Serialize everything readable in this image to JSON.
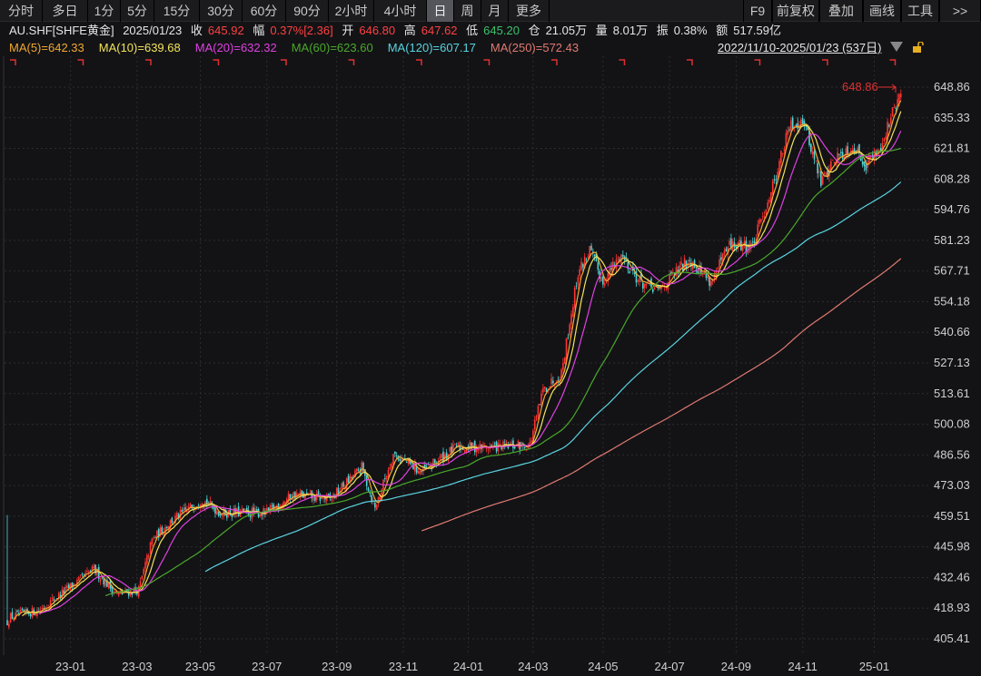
{
  "toolbar": {
    "left": [
      "分时",
      "多日",
      "1分",
      "5分",
      "15分",
      "30分",
      "60分",
      "90分",
      "2小时",
      "4小时",
      "日",
      "周",
      "月",
      "更多"
    ],
    "selected": "日",
    "right": [
      "F9",
      "前复权",
      "叠加",
      "画线",
      "工具",
      ">>"
    ]
  },
  "info": {
    "symbol": "AU.SHF[SHFE黄金]",
    "date": "2025/01/23",
    "close_label": "收",
    "close": "645.92",
    "change_label": "幅",
    "change": "0.37%[2.36]",
    "open_label": "开",
    "open": "646.80",
    "high_label": "高",
    "high": "647.62",
    "low_label": "低",
    "low": "645.20",
    "oi_label": "仓",
    "oi": "21.05万",
    "vol_label": "量",
    "vol": "8.01万",
    "amp_label": "振",
    "amp": "0.38%",
    "amt_label": "额",
    "amt": "517.59亿"
  },
  "ma_legend": [
    {
      "text": "MA(5)=642.33",
      "color": "#f0a830"
    },
    {
      "text": "MA(10)=639.68",
      "color": "#f2e35c"
    },
    {
      "text": "MA(20)=632.32",
      "color": "#e040e0"
    },
    {
      "text": "MA(60)=623.60",
      "color": "#4aa82a"
    },
    {
      "text": "MA(120)=607.17",
      "color": "#5ad4e0"
    },
    {
      "text": "MA(250)=572.43",
      "color": "#e07a70"
    }
  ],
  "range": "2022/11/10-2025/01/23 (537日)",
  "chart_data": {
    "type": "candlestick",
    "last_price_label": "648.86",
    "y_ticks": [
      "648.86",
      "635.33",
      "621.81",
      "608.28",
      "594.76",
      "581.23",
      "567.71",
      "554.18",
      "540.66",
      "527.13",
      "513.61",
      "500.08",
      "486.56",
      "473.03",
      "459.51",
      "445.98",
      "432.46",
      "418.93",
      "405.41"
    ],
    "ylim": [
      405.41,
      648.86
    ],
    "x_ticks": [
      {
        "label": "23-01",
        "day": 38
      },
      {
        "label": "23-03",
        "day": 78
      },
      {
        "label": "23-05",
        "day": 116
      },
      {
        "label": "23-07",
        "day": 156
      },
      {
        "label": "23-09",
        "day": 198
      },
      {
        "label": "23-11",
        "day": 238
      },
      {
        "label": "24-01",
        "day": 277
      },
      {
        "label": "24-03",
        "day": 316
      },
      {
        "label": "24-05",
        "day": 358
      },
      {
        "label": "24-07",
        "day": 398
      },
      {
        "label": "24-09",
        "day": 438
      },
      {
        "label": "24-11",
        "day": 478
      },
      {
        "label": "25-01",
        "day": 521
      }
    ],
    "trading_days": 538,
    "close_waypoints": [
      [
        0,
        413
      ],
      [
        2,
        415
      ],
      [
        19,
        418
      ],
      [
        52,
        436
      ],
      [
        66,
        425
      ],
      [
        79,
        427
      ],
      [
        87,
        449
      ],
      [
        98,
        457
      ],
      [
        117,
        467
      ],
      [
        128,
        461
      ],
      [
        156,
        461
      ],
      [
        172,
        469
      ],
      [
        194,
        467
      ],
      [
        213,
        481
      ],
      [
        221,
        463
      ],
      [
        232,
        487
      ],
      [
        249,
        479
      ],
      [
        270,
        490
      ],
      [
        292,
        490
      ],
      [
        314,
        491
      ],
      [
        322,
        515
      ],
      [
        333,
        523
      ],
      [
        343,
        567
      ],
      [
        350,
        577
      ],
      [
        358,
        563
      ],
      [
        369,
        575
      ],
      [
        380,
        563
      ],
      [
        391,
        559
      ],
      [
        410,
        573
      ],
      [
        423,
        563
      ],
      [
        434,
        579
      ],
      [
        448,
        579
      ],
      [
        459,
        603
      ],
      [
        470,
        631
      ],
      [
        478,
        635
      ],
      [
        489,
        607
      ],
      [
        497,
        617
      ],
      [
        508,
        623
      ],
      [
        516,
        615
      ],
      [
        525,
        623
      ],
      [
        533,
        639
      ],
      [
        537,
        645.92
      ]
    ],
    "ma_periods": [
      5,
      10,
      20,
      60,
      120,
      250
    ],
    "up_color": "#ff3333",
    "down_color": "#4fd6d6"
  }
}
